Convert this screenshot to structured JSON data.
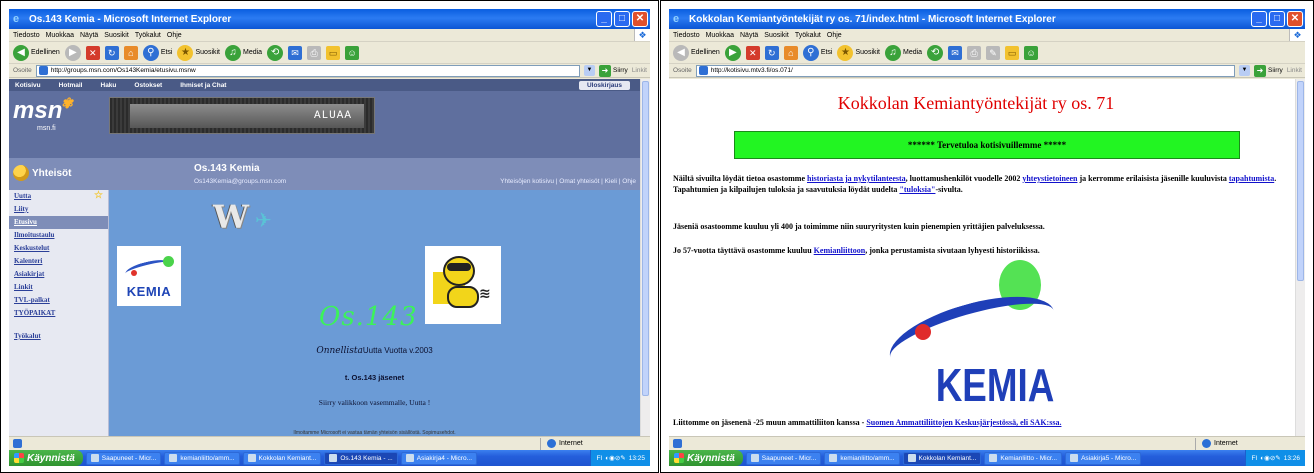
{
  "left": {
    "window_title": "Os.143 Kemia - Microsoft Internet Explorer",
    "menu": [
      "Tiedosto",
      "Muokkaa",
      "Näytä",
      "Suosikit",
      "Työkalut",
      "Ohje"
    ],
    "toolbar": {
      "back": "Edellinen",
      "search": "Etsi",
      "favorites": "Suosikit",
      "media": "Media"
    },
    "address_label": "Osoite",
    "address": "http://groups.msn.com/Os143Kemia/etusivu.msnw",
    "go": "Siirry",
    "links": "Linkit",
    "msn_nav": [
      "Kotisivu",
      "Hotmail",
      "Haku",
      "Ostokset",
      "Ihmiset ja Chat"
    ],
    "logout": "Uloskirjaus",
    "msn_logo": "msn",
    "msn_sub": "msn.fi",
    "ad_text": "ALUAA",
    "section": "Yhteisöt",
    "community_title": "Os.143 Kemia",
    "community_email": "Os143Kemia@groups.msn.com",
    "community_links": "Yhteisöjen kotisivu | Omat yhteisöt | Kieli | Ohje",
    "sidebar": [
      "Uutta",
      "Liity",
      "Etusivu",
      "Ilmoitustaulu",
      "Keskustelut",
      "Kalenteri",
      "Asiakirjat",
      "Linkit",
      "TVL-palkat",
      "TYÖPAIKAT",
      "Työkalut"
    ],
    "kemia_logo": "KEMIA",
    "os_text": "Os.143",
    "wish_italic": "Onnellista",
    "wish_rest": "Uutta Vuotta v.2003",
    "sender": "t. Os.143 jäsenet",
    "hint": "Siirry valikkoon vasemmalle, Uutta !",
    "footer": "Ilmoitamme Microsoft ei vastaa tämän yhteisön sisällöstä. Sopimusehdot.",
    "status_zone": "Internet"
  },
  "right": {
    "window_title": "Kokkolan Kemiantyöntekijät ry os. 71/index.html - Microsoft Internet Explorer",
    "menu": [
      "Tiedosto",
      "Muokkaa",
      "Näytä",
      "Suosikit",
      "Työkalut",
      "Ohje"
    ],
    "toolbar": {
      "back": "Edellinen",
      "search": "Etsi",
      "favorites": "Suosikit",
      "media": "Media"
    },
    "address_label": "Osoite",
    "address": "http://kotisivu.mtv3.fi/os.071/",
    "go": "Siirry",
    "links": "Linkit",
    "heading": "Kokkolan Kemiantyöntekijät ry os. 71",
    "banner": "****** Tervetuloa kotisivuillemme *****",
    "p1": {
      "t1": "Näiltä sivuilta löydät tietoa osastomme ",
      "l1": "historiasta ja nykytilanteesta",
      "t2": ", luottamushenkilöt vuodelle 2002 ",
      "l2": "yhteystietoineen",
      "t3": " ja kerromme erilaisista jäsenille kuuluvista ",
      "l3": "tapahtumista",
      "t4": ". Tapahtumien ja kilpailujen tuloksia ja saavutuksia löydät uudelta ",
      "l4": "\"tuloksia\"",
      "t5": "-sivulta."
    },
    "p2": "Jäseniä osastoomme kuuluu yli 400 ja toimimme niin suuryritysten kuin pienempien yrittäjien palveluksessa.",
    "p3": {
      "t1": "Jo 57-vuotta täyttävä osastomme kuuluu ",
      "l1": "Kemianliittoon",
      "t2": ", jonka perustamista sivutaan lyhyesti historiikissa."
    },
    "kemia_logo": "KEMIA",
    "p4": {
      "t1": "Liittomme on jäsenenä -25 muun ammattiliiton kanssa - ",
      "l1": "Suomen Ammattiliittojen Keskusjärjestössä, eli SAK:ssa."
    },
    "status_zone": "Internet"
  },
  "taskbar": {
    "start": "Käynnistä",
    "left_tasks": [
      "Saapuneet - Micr...",
      "kemianliitto/amm...",
      "Kokkolan Kemiant...",
      "Os.143 Kemia - ...",
      "Asiakirja4 - Micro..."
    ],
    "left_clock": "13:25",
    "right_tasks": [
      "Saapuneet - Micr...",
      "kemianliitto/amm...",
      "Kokkolan Kemiant...",
      "Kemianliitto - Micr...",
      "Asiakirja5 - Micro..."
    ],
    "right_clock": "13:26",
    "lang": "FI"
  },
  "colors": {
    "xp_blue": "#245edb",
    "msn_header": "#5f6f9e",
    "content_blue": "#6b9bd6",
    "banner_green": "#22f522",
    "heading_red": "#e00000"
  }
}
